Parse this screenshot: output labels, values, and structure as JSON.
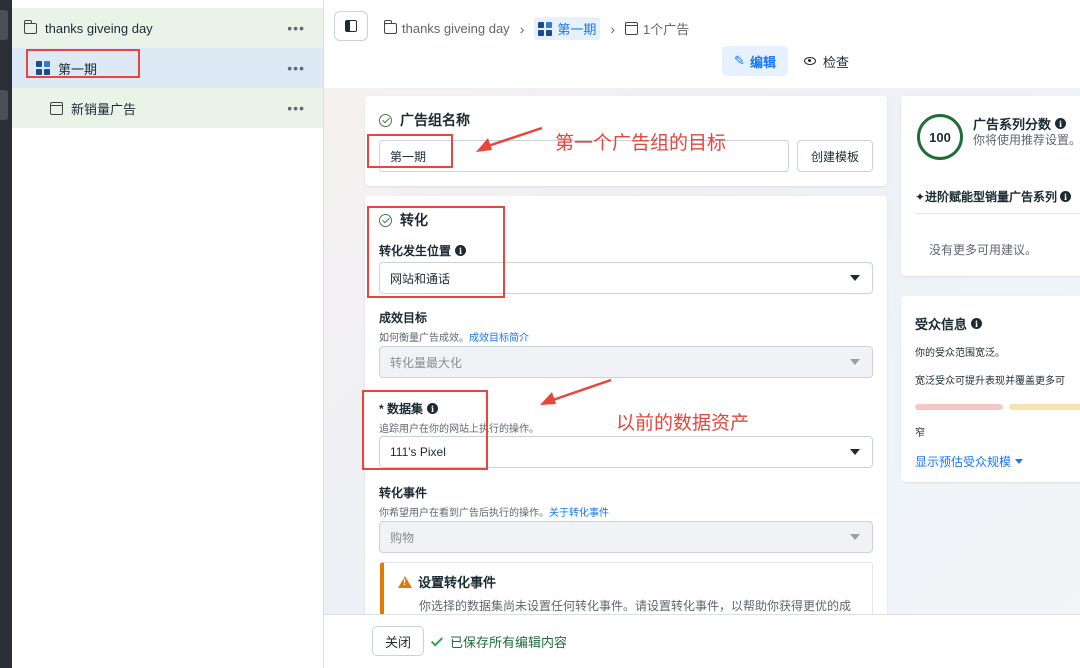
{
  "sidebar": {
    "campaign": {
      "label": "thanks giveing day",
      "more": "•••"
    },
    "adset": {
      "label": "第一期",
      "more": "•••"
    },
    "ad": {
      "label": "新销量广告",
      "more": "•••"
    }
  },
  "header": {
    "breadcrumb": [
      {
        "label": "thanks giveing day",
        "icon": "folder-icon"
      },
      {
        "label": "第一期",
        "icon": "grid-icon"
      },
      {
        "label": "1个广告",
        "icon": "ad-icon"
      }
    ],
    "modes": {
      "edit": "编辑",
      "review": "检查"
    }
  },
  "adset_name": {
    "title": "广告组名称",
    "value": "第一期",
    "create_template": "创建模板"
  },
  "conversion": {
    "title": "转化",
    "location": {
      "label": "转化发生位置",
      "value": "网站和通话"
    },
    "goal": {
      "label": "成效目标",
      "help": "如何衡量广告成效。",
      "help_link": "成效目标简介",
      "value": "转化量最大化"
    },
    "dataset": {
      "label": "* 数据集",
      "help": "追踪用户在你的网站上执行的操作。",
      "value": "111's Pixel"
    },
    "event": {
      "label": "转化事件",
      "help": "你希望用户在看到广告后执行的操作。",
      "help_link": "关于转化事件",
      "value": "购物"
    },
    "warning": {
      "title": "设置转化事件",
      "text": "你选择的数据集尚未设置任何转化事件。请设置转化事件，以帮助你获得更优的成"
    }
  },
  "annotations": {
    "first_goal": "第一个广告组的目标",
    "previous_data": "以前的数据资产"
  },
  "score": {
    "value": "100",
    "title": "广告系列分数",
    "subtitle": "你将使用推荐设置。",
    "feature": "✦进阶赋能型销量广告系列",
    "empty": "没有更多可用建议。"
  },
  "audience": {
    "title": "受众信息",
    "line1": "你的受众范围宽泛。",
    "line2": "宽泛受众可提升表现并覆盖更多可",
    "narrow": "窄",
    "link": "显示预估受众规模"
  },
  "footer": {
    "close": "关闭",
    "saved": "已保存所有编辑内容"
  },
  "colors": {
    "accent": "#1877f2",
    "annotation": "#e8453c",
    "success": "#1f6e3a",
    "warning": "#e07b00"
  }
}
